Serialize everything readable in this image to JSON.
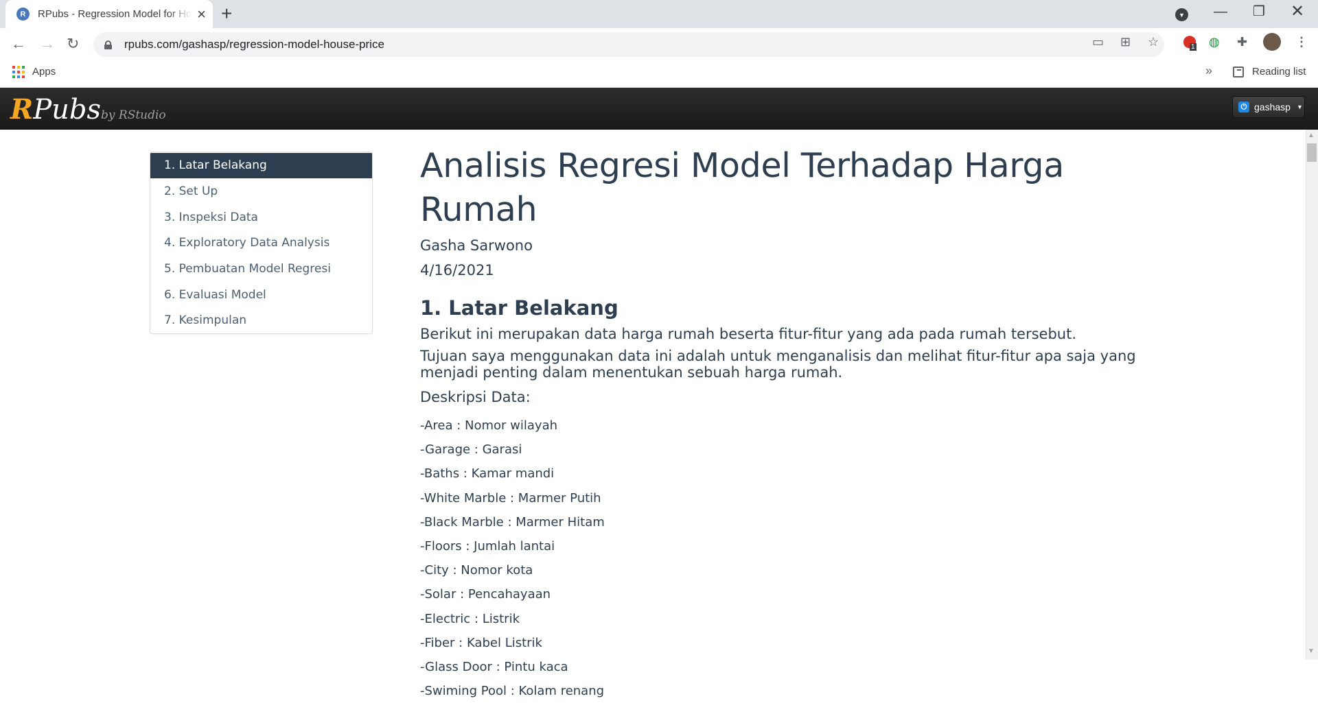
{
  "browser": {
    "tab_title": "RPubs - Regression Model for House Price",
    "tab_favicon_letter": "R",
    "url": "rpubs.com/gashasp/regression-model-house-price",
    "extension_badge": "1",
    "bookmarks_apps_label": "Apps",
    "reading_list_label": "Reading list"
  },
  "navbar": {
    "brand_r": "R",
    "brand_pubs": "Pubs",
    "brand_sub": "by RStudio",
    "user": "gashasp"
  },
  "toc": [
    {
      "label": "1. Latar Belakang",
      "active": true
    },
    {
      "label": "2. Set Up"
    },
    {
      "label": "3. Inspeksi Data"
    },
    {
      "label": "4. Exploratory Data Analysis"
    },
    {
      "label": "5. Pembuatan Model Regresi"
    },
    {
      "label": "6. Evaluasi Model"
    },
    {
      "label": "7. Kesimpulan"
    }
  ],
  "document": {
    "title": "Analisis Regresi Model Terhadap Harga Rumah",
    "author": "Gasha Sarwono",
    "date": "4/16/2021",
    "section_heading": "1. Latar Belakang",
    "para1": "Berikut ini merupakan data harga rumah beserta fitur-fitur yang ada pada rumah tersebut.",
    "para2": "Tujuan saya menggunakan data ini adalah untuk menganalisis dan melihat fitur-fitur apa saja yang menjadi penting dalam menentukan sebuah harga rumah.",
    "desc_heading": "Deskripsi Data:",
    "desc_items": [
      "-Area : Nomor wilayah",
      "-Garage : Garasi",
      "-Baths : Kamar mandi",
      "-White Marble : Marmer Putih",
      "-Black Marble : Marmer Hitam",
      "-Floors : Jumlah lantai",
      "-City : Nomor kota",
      "-Solar : Pencahayaan",
      "-Electric : Listrik",
      "-Fiber : Kabel Listrik",
      "-Glass Door : Pintu kaca",
      "-Swiming Pool : Kolam renang"
    ]
  }
}
